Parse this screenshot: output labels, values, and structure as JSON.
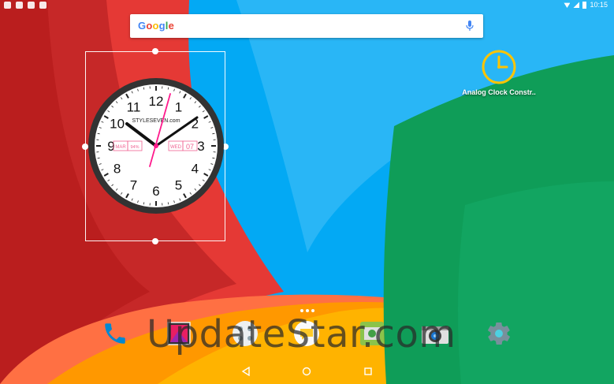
{
  "status_bar": {
    "time": "10:15"
  },
  "search": {
    "brand": "Google"
  },
  "clock_widget": {
    "brand_text": "STYLESEVEN.com",
    "month": "MAR",
    "battery": "94%",
    "weekday": "WED",
    "day": "07",
    "numbers": [
      "12",
      "1",
      "2",
      "3",
      "4",
      "5",
      "6",
      "7",
      "8",
      "9",
      "10",
      "11"
    ]
  },
  "app_shortcut": {
    "label": "Analog Clock Constr.."
  },
  "dock": {
    "items": [
      {
        "name": "phone-icon"
      },
      {
        "name": "gallery-icon"
      },
      {
        "name": "apps-icon"
      },
      {
        "name": "messaging-icon"
      },
      {
        "name": "gallery2-icon"
      },
      {
        "name": "camera-icon"
      },
      {
        "name": "settings-icon"
      }
    ]
  },
  "watermark": "UpdateStar.com",
  "colors": {
    "red": "#e53935",
    "blue": "#03a9f4",
    "green": "#0f9d58",
    "orange": "#ff9800",
    "clock_pink": "#ff1a8c",
    "shortcut_yellow": "#ffc400"
  }
}
